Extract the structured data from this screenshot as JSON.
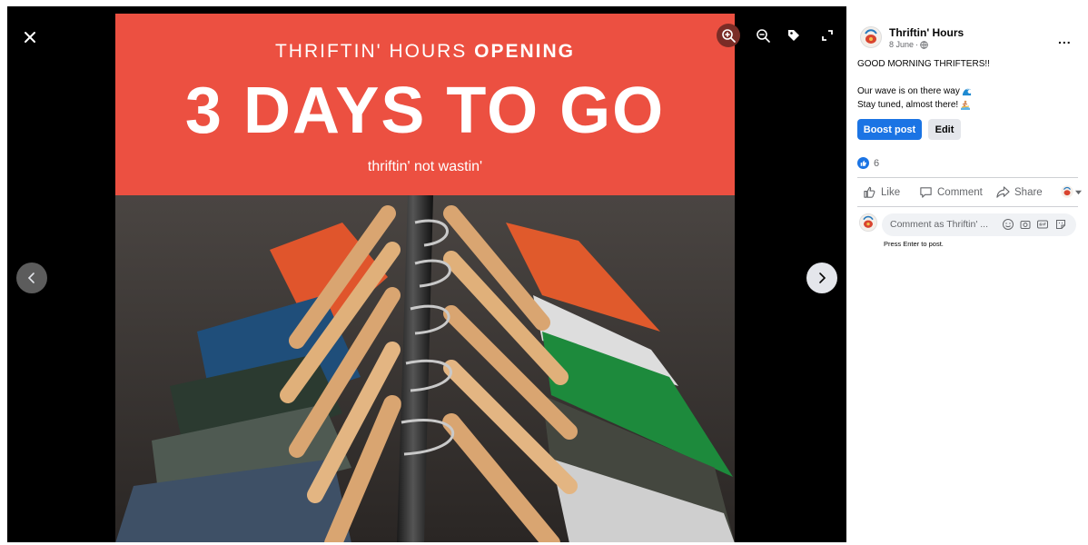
{
  "viewer": {
    "banner": {
      "title_regular": "THRIFTIN' HOURS ",
      "title_bold": "OPENING",
      "headline": "3 DAYS TO GO",
      "tagline": "thriftin' not wastin'"
    },
    "toolbar_icons": [
      "zoom-in-icon",
      "zoom-out-icon",
      "tag-icon",
      "fullscreen-icon"
    ],
    "colors": {
      "banner": "#ec5041",
      "zoom_active": "#7a2c26"
    }
  },
  "post": {
    "page_name": "Thriftin' Hours",
    "date": "8 June",
    "date_separator": "·",
    "more_label": "...",
    "greeting": "GOOD MORNING THRIFTERS!!",
    "line2": "Our wave is on there way",
    "line3": "Stay tuned, almost there!",
    "boost_label": "Boost post",
    "edit_label": "Edit",
    "reaction_count": "6",
    "actions": {
      "like": "Like",
      "comment": "Comment",
      "share": "Share"
    },
    "comment": {
      "placeholder": "Comment as Thriftin' ...",
      "hint": "Press Enter to post."
    },
    "colors": {
      "primary": "#1b74e4",
      "secondary_bg": "#e4e6eb",
      "muted_text": "#65676b"
    }
  }
}
